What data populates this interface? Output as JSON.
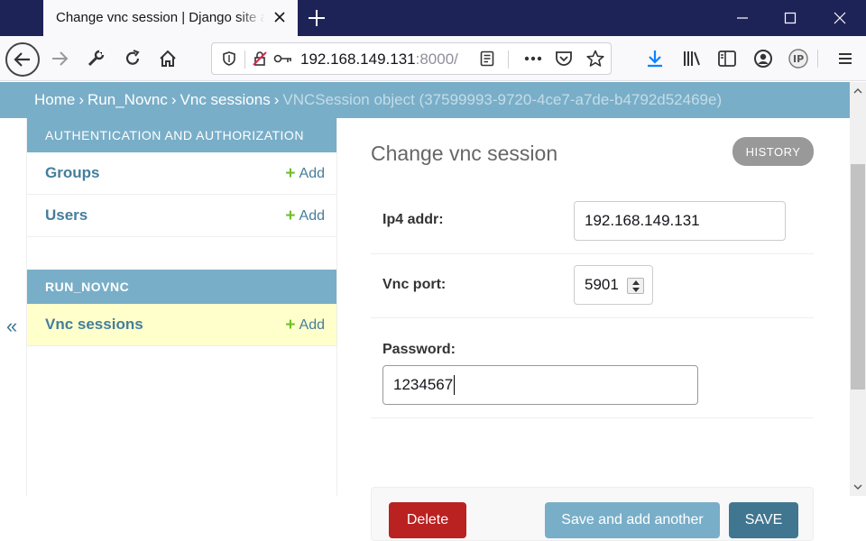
{
  "browser": {
    "tab_title": "Change vnc session | Django site admin",
    "url_host": "192.168.149.131",
    "url_rest": ":8000/"
  },
  "breadcrumbs": {
    "home": "Home",
    "app": "Run_Novnc",
    "model": "Vnc sessions",
    "current": "VNCSession object (37599993-9720-4ce7-a7de-b4792d52469e)",
    "separator": "›"
  },
  "sidebar": {
    "collapse_glyph": "«",
    "modules": [
      {
        "caption": "AUTHENTICATION AND AUTHORIZATION",
        "models": [
          {
            "name": "Groups",
            "add": "Add"
          },
          {
            "name": "Users",
            "add": "Add"
          }
        ]
      },
      {
        "caption": "RUN_NOVNC",
        "models": [
          {
            "name": "Vnc sessions",
            "add": "Add"
          }
        ]
      }
    ]
  },
  "content": {
    "title": "Change vnc session",
    "history": "HISTORY",
    "fields": {
      "ip4": {
        "label": "Ip4 addr:",
        "value": "192.168.149.131"
      },
      "port": {
        "label": "Vnc port:",
        "value": "5901"
      },
      "password": {
        "label": "Password:",
        "value": "1234567"
      }
    },
    "buttons": {
      "delete": "Delete",
      "save_add_another": "Save and add another",
      "save": "SAVE"
    }
  },
  "colors": {
    "header_blue": "#79aec8",
    "link_blue": "#447e9b",
    "delete_red": "#ba2121",
    "save_blue": "#417690",
    "add_green": "#70bf2b",
    "current_row": "#ffffcc",
    "titlebar": "#1e2357"
  },
  "icons": [
    "close-icon",
    "plus-icon",
    "minimize-icon",
    "maximize-icon",
    "back-icon",
    "forward-icon",
    "wrench-icon",
    "reload-icon",
    "home-icon",
    "shield-icon",
    "insecure-lock-icon",
    "key-icon",
    "reader-icon",
    "more-icon",
    "pocket-icon",
    "star-icon",
    "download-icon",
    "library-icon",
    "sidebar-icon",
    "account-icon",
    "ip-icon",
    "menu-icon"
  ]
}
